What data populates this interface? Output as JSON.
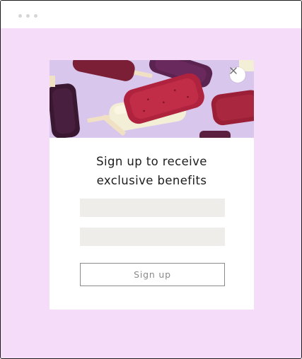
{
  "window": {
    "controls": [
      "dot",
      "dot",
      "dot"
    ]
  },
  "colors": {
    "page_background": "#f5dcf8",
    "modal_background": "#ffffff",
    "field_background": "#eeede9",
    "button_border": "#8a8a8a",
    "heading_text": "#1c1c1c"
  },
  "modal": {
    "hero_image": "popsicles-photo",
    "close_icon": "close-icon",
    "heading_line1": "Sign up to receive",
    "heading_line2": "exclusive benefits",
    "field1_value": "",
    "field2_value": "",
    "submit_label": "Sign up"
  }
}
